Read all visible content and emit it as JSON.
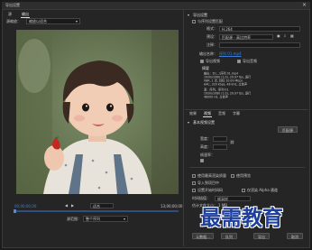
{
  "window": {
    "title": "导出设置"
  },
  "left": {
    "tabs": [
      "源",
      "输出"
    ],
    "source_scaling_label": "源缩放：",
    "source_scaling_value": "缩放以适合",
    "timecode_start": "00;00;00;00",
    "timecode_end": "13;00;00;00",
    "source_range_label": "源范围：",
    "source_range_value": "整个序列",
    "fit_label": "适合"
  },
  "right": {
    "export_settings_header": "导出设置",
    "match_sequence": "与序列设置匹配",
    "format_label": "格式：",
    "format_value": "H.264",
    "preset_label": "预设：",
    "preset_value": "匹配源 - 高比特率",
    "comment_label": "注释：",
    "output_name_label": "输出名称：",
    "output_name_value": "序列 01.mp4",
    "export_video": "导出视频",
    "export_audio": "导出音频",
    "summary_header": "摘要",
    "summary_output_lines": [
      "输出：D:\\...\\序列 01.mp4",
      "1920x1080 (1.0), 29.97 fps, 逐行",
      "VBR, 1 次, 目标 10.00 Mbps",
      "AAC, 320 kbps, 48 kHz, 立体声"
    ],
    "summary_source_lines": [
      "源：序列，序列 01",
      "1920x1080 (1.0), 29.97 fps, 逐行",
      "48000 Hz, 立体声"
    ],
    "tabs": [
      "效果",
      "视频",
      "音频",
      "字幕"
    ],
    "basic_settings_header": "基本视频设置",
    "match_source_button": "匹配源",
    "width_label": "宽度：",
    "height_label": "高度：",
    "frame_rate_label": "帧速率：",
    "use_max_quality": "使用最高渲染质量",
    "use_previews": "使用预览",
    "import_into_project": "导入到项目中",
    "set_start_timecode": "设置开始时间码",
    "render_alpha": "仅渲染 Alpha 通道",
    "time_interpolation_label": "时间插值：",
    "time_interpolation_value": "帧采样",
    "estimated_size_label": "估计文件大小：",
    "estimated_size_value": "1 MB",
    "metadata_button": "元数据...",
    "queue_button": "队列",
    "export_button": "导出",
    "cancel_button": "取消"
  },
  "watermark": "最需教育"
}
